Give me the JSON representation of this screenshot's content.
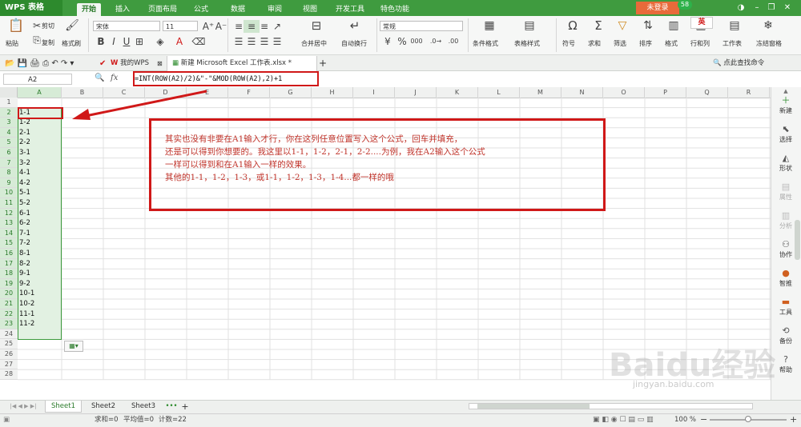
{
  "app": {
    "name": "WPS 表格"
  },
  "menu_tabs": [
    "开始",
    "插入",
    "页面布局",
    "公式",
    "数据",
    "审阅",
    "视图",
    "开发工具",
    "特色功能"
  ],
  "login_label": "未登录",
  "badge_count": "58",
  "ribbon": {
    "paste": "粘贴",
    "cut": "剪切",
    "copy": "复制",
    "format_painter": "格式刷",
    "font_name": "宋体",
    "font_size": "11",
    "merge_center": "合并居中",
    "wrap": "自动换行",
    "number_format": "常规",
    "cond_format": "条件格式",
    "table_style": "表格样式",
    "symbol": "符号",
    "sum": "求和",
    "filter": "筛选",
    "sort": "排序",
    "format": "格式",
    "row_col": "行和列",
    "worksheet": "工作表",
    "freeze": "冻结窗格",
    "percent": "%",
    "thousands": "000",
    "ime": "英"
  },
  "doc_tabs": {
    "my_wps": "我的WPS",
    "active_file": "新建 Microsoft Excel 工作表.xlsx *",
    "search_hint": "点此查找命令"
  },
  "name_box": "A2",
  "fx": "fx",
  "formula": "=INT(ROW(A2)/2)&\"-\"&MOD(ROW(A2),2)+1",
  "columns": [
    "A",
    "B",
    "C",
    "D",
    "E",
    "F",
    "G",
    "H",
    "I",
    "J",
    "K",
    "L",
    "M",
    "N",
    "O",
    "P",
    "Q",
    "R"
  ],
  "rows": [
    "1",
    "2",
    "3",
    "4",
    "5",
    "6",
    "7",
    "8",
    "9",
    "10",
    "11",
    "12",
    "13",
    "14",
    "15",
    "16",
    "17",
    "18",
    "19",
    "20",
    "21",
    "22",
    "23",
    "24",
    "25",
    "26",
    "27",
    "28"
  ],
  "column_a_values": [
    "",
    "1-1",
    "1-2",
    "2-1",
    "2-2",
    "3-1",
    "3-2",
    "4-1",
    "4-2",
    "5-1",
    "5-2",
    "6-1",
    "6-2",
    "7-1",
    "7-2",
    "8-1",
    "8-2",
    "9-1",
    "9-2",
    "10-1",
    "10-2",
    "11-1",
    "11-2"
  ],
  "note": {
    "lines": [
      "其实也没有非要在A1输入才行，你在这列任意位置写入这个公式，回车并填充，",
      "还是可以得到你想要的。我这里以1-1，1-2，2-1，2-2....为例，我在A2输入这个公式",
      "一样可以得到和在A1输入一样的效果。",
      "其他的1-1，1-2，1-3，或1-1，1-2，1-3，1-4...都一样的哦"
    ]
  },
  "sidebar": [
    "新建",
    "选择",
    "形状",
    "属性",
    "分析",
    "协作",
    "智推",
    "工具",
    "备份",
    "帮助"
  ],
  "sheets": [
    "Sheet1",
    "Sheet2",
    "Sheet3"
  ],
  "status": {
    "sum": "求和=0",
    "avg": "平均值=0",
    "count": "计数=22",
    "zoom": "100 %"
  },
  "watermark": {
    "text": "Baidu经验",
    "url": "jingyan.baidu.com"
  },
  "colors": {
    "brand_green": "#3f9b3f",
    "highlight_red": "#d01818",
    "note_text": "#c0342b"
  }
}
